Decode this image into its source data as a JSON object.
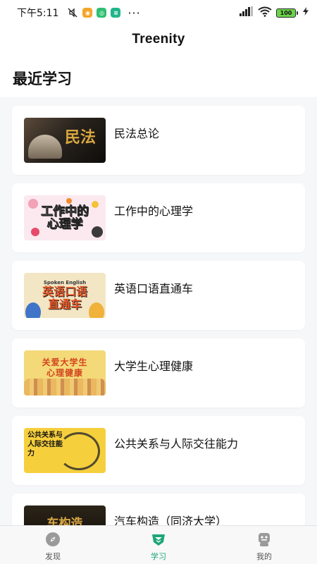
{
  "status_bar": {
    "time": "下午5:11",
    "battery": "100",
    "icons": [
      "mute-icon",
      "app-notification-icon",
      "app-notification-icon",
      "app-notification-icon",
      "more-dots-icon",
      "signal-icon",
      "wifi-icon",
      "battery-icon",
      "charging-icon"
    ]
  },
  "header": {
    "title": "Treenity"
  },
  "section": {
    "title": "最近学习"
  },
  "courses": [
    {
      "title": "民法总论",
      "thumb_text": "民法"
    },
    {
      "title": "工作中的心理学",
      "thumb_text": "工作中的心理学"
    },
    {
      "title": "英语口语直通车",
      "thumb_text": "英语口语直通车",
      "thumb_sub": "Spoken English"
    },
    {
      "title": "大学生心理健康",
      "thumb_text": "关爱大学生心理健康"
    },
    {
      "title": "公共关系与人际交往能力",
      "thumb_text": "公共关系与人际交往能力"
    },
    {
      "title": "汽车构造（同济大学）",
      "thumb_text": "车构造"
    }
  ],
  "tabbar": {
    "tabs": [
      {
        "label": "发现",
        "icon": "compass-icon",
        "active": false
      },
      {
        "label": "学习",
        "icon": "study-icon",
        "active": true
      },
      {
        "label": "我的",
        "icon": "profile-icon",
        "active": false
      }
    ]
  },
  "colors": {
    "accent": "#1ea57a",
    "background": "#f6f7f9"
  }
}
